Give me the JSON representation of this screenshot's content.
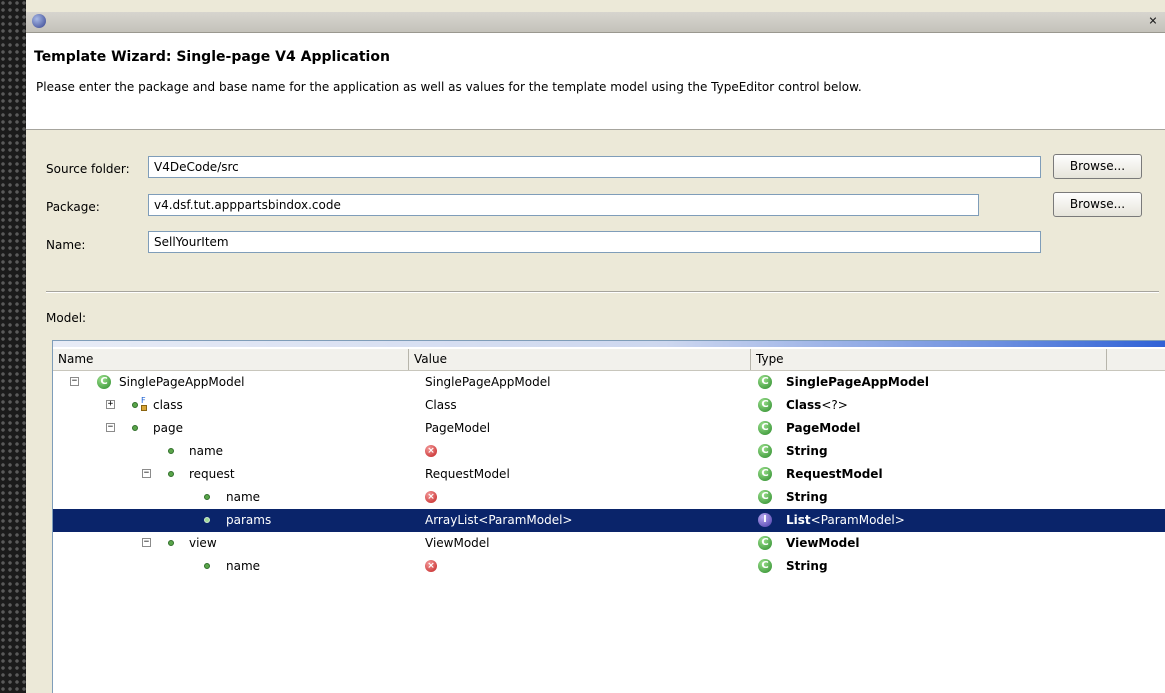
{
  "window": {
    "close_glyph": "×"
  },
  "header": {
    "title": "Template Wizard: Single-page V4 Application",
    "description": "Please enter the package and base name for the application as well as values for the template model using the TypeEditor control below."
  },
  "form": {
    "source_folder_label": "Source folder:",
    "source_folder_value": "V4DeCode/src",
    "package_label": "Package:",
    "package_value": "v4.dsf.tut.apppartsbindox.code",
    "name_label": "Name:",
    "name_value": "SellYourItem",
    "browse_label": "Browse..."
  },
  "model": {
    "label": "Model:",
    "columns": [
      "Name",
      "Value",
      "Type"
    ],
    "rows": [
      {
        "name": "SinglePageAppModel",
        "value": "SinglePageAppModel",
        "type": "SinglePageAppModel",
        "type_suffix": ""
      },
      {
        "name": "class",
        "value": "Class",
        "type": "Class",
        "type_suffix": "<?>"
      },
      {
        "name": "page",
        "value": "PageModel",
        "type": "PageModel",
        "type_suffix": ""
      },
      {
        "name": "name",
        "value": "",
        "type": "String",
        "type_suffix": ""
      },
      {
        "name": "request",
        "value": "RequestModel",
        "type": "RequestModel",
        "type_suffix": ""
      },
      {
        "name": "name",
        "value": "",
        "type": "String",
        "type_suffix": ""
      },
      {
        "name": "params",
        "value": "ArrayList<ParamModel>",
        "type": "List",
        "type_suffix": "<ParamModel>"
      },
      {
        "name": "view",
        "value": "ViewModel",
        "type": "ViewModel",
        "type_suffix": ""
      },
      {
        "name": "name",
        "value": "",
        "type": "String",
        "type_suffix": ""
      }
    ]
  },
  "colors": {
    "selection": "#0a246a",
    "dialog": "#ece9d8"
  }
}
